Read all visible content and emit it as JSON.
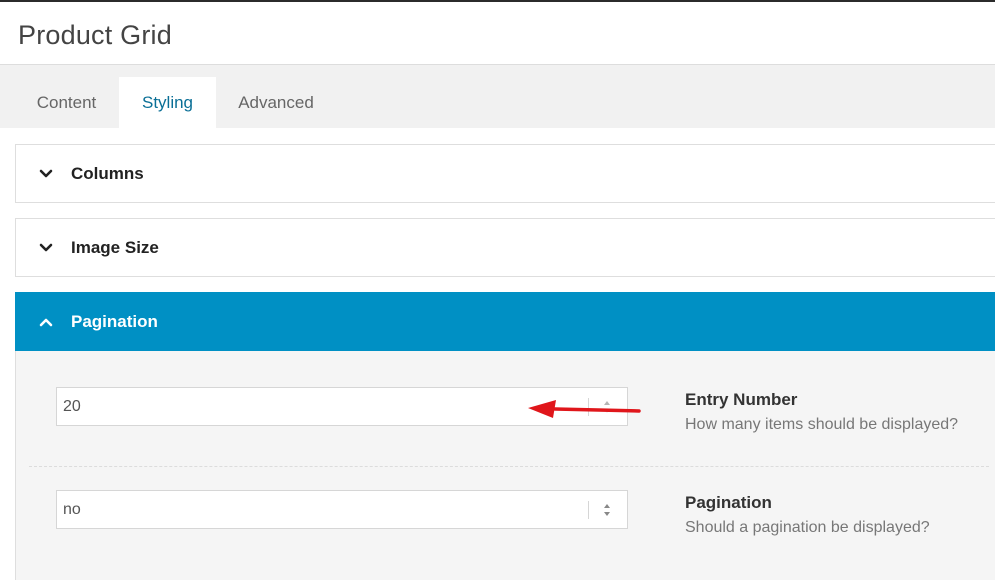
{
  "header": {
    "title": "Product Grid"
  },
  "tabs": [
    {
      "label": "Content"
    },
    {
      "label": "Styling"
    },
    {
      "label": "Advanced"
    }
  ],
  "sections": [
    {
      "label": "Columns"
    },
    {
      "label": "Image Size"
    },
    {
      "label": "Pagination"
    }
  ],
  "pagination": {
    "entry_number": {
      "value": "20",
      "label": "Entry Number",
      "description": "How many items should be displayed?"
    },
    "pagination": {
      "value": "no",
      "label": "Pagination",
      "description": "Should a pagination be displayed?"
    }
  },
  "colors": {
    "accent": "#0090c4",
    "active_tab_text": "#0a6f96",
    "annotation_arrow": "#e0161b"
  }
}
